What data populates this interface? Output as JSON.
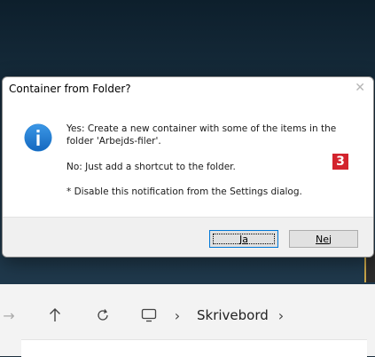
{
  "dialog": {
    "title": "Container from Folder?",
    "close_glyph": "✕",
    "message_yes": "Yes: Create a new container with some of the items in the folder 'Arbejds-filer'.",
    "message_no": "No: Just add a shortcut to the folder.",
    "message_note": "* Disable this notification from the Settings dialog.",
    "icon": "info-icon",
    "buttons": {
      "yes_label": "Ja",
      "no_label": "Nej"
    },
    "annotation_badge": "3"
  },
  "explorer": {
    "breadcrumb": "Skrivebord",
    "forward_glyph": "→",
    "up_glyph": "↑",
    "refresh_glyph": "↻",
    "chevron_glyph": "›",
    "pc_icon": "monitor-icon"
  },
  "colors": {
    "accent": "#0078d7",
    "info_icon": "#1a7bd1",
    "badge": "#d3232d"
  }
}
